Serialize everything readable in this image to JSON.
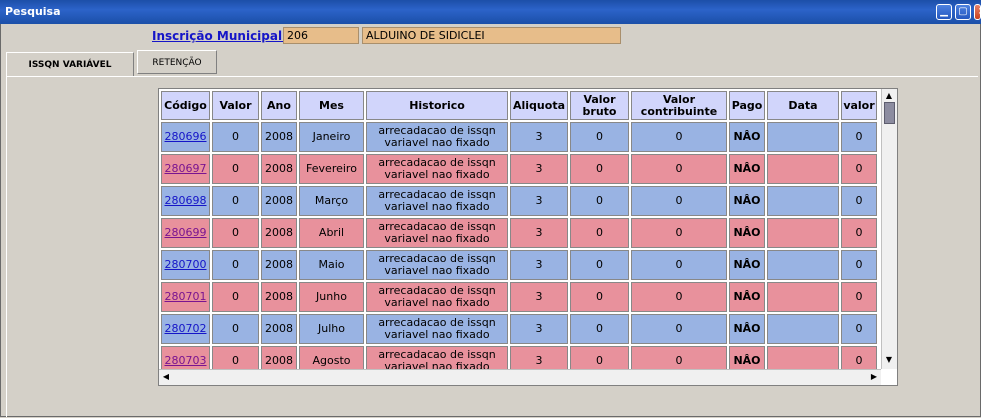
{
  "window": {
    "title": "Pesquisa"
  },
  "header": {
    "label": "Inscrição Municipal:",
    "inscricao": "206",
    "nome": "ALDUINO DE SIDICLEI"
  },
  "tabs": [
    {
      "label": "ISSQN VARIÁVEL",
      "active": true
    },
    {
      "label": "RETENÇÃO",
      "active": false
    }
  ],
  "table": {
    "columns": [
      "Código",
      "Valor",
      "Ano",
      "Mes",
      "Historico",
      "Aliquota",
      "Valor bruto",
      "Valor contribuinte",
      "Pago",
      "Data",
      "valor"
    ],
    "rows": [
      {
        "codigo": "280696",
        "valor": "0",
        "ano": "2008",
        "mes": "Janeiro",
        "historico": "arrecadacao de issqn variavel nao fixado",
        "aliquota": "3",
        "bruto": "0",
        "contribuinte": "0",
        "pago": "NÂO",
        "data": "",
        "valor2": "0"
      },
      {
        "codigo": "280697",
        "valor": "0",
        "ano": "2008",
        "mes": "Fevereiro",
        "historico": "arrecadacao de issqn variavel nao fixado",
        "aliquota": "3",
        "bruto": "0",
        "contribuinte": "0",
        "pago": "NÂO",
        "data": "",
        "valor2": "0"
      },
      {
        "codigo": "280698",
        "valor": "0",
        "ano": "2008",
        "mes": "Março",
        "historico": "arrecadacao de issqn variavel nao fixado",
        "aliquota": "3",
        "bruto": "0",
        "contribuinte": "0",
        "pago": "NÂO",
        "data": "",
        "valor2": "0"
      },
      {
        "codigo": "280699",
        "valor": "0",
        "ano": "2008",
        "mes": "Abril",
        "historico": "arrecadacao de issqn variavel nao fixado",
        "aliquota": "3",
        "bruto": "0",
        "contribuinte": "0",
        "pago": "NÂO",
        "data": "",
        "valor2": "0"
      },
      {
        "codigo": "280700",
        "valor": "0",
        "ano": "2008",
        "mes": "Maio",
        "historico": "arrecadacao de issqn variavel nao fixado",
        "aliquota": "3",
        "bruto": "0",
        "contribuinte": "0",
        "pago": "NÂO",
        "data": "",
        "valor2": "0"
      },
      {
        "codigo": "280701",
        "valor": "0",
        "ano": "2008",
        "mes": "Junho",
        "historico": "arrecadacao de issqn variavel nao fixado",
        "aliquota": "3",
        "bruto": "0",
        "contribuinte": "0",
        "pago": "NÂO",
        "data": "",
        "valor2": "0"
      },
      {
        "codigo": "280702",
        "valor": "0",
        "ano": "2008",
        "mes": "Julho",
        "historico": "arrecadacao de issqn variavel nao fixado",
        "aliquota": "3",
        "bruto": "0",
        "contribuinte": "0",
        "pago": "NÂO",
        "data": "",
        "valor2": "0"
      },
      {
        "codigo": "280703",
        "valor": "0",
        "ano": "2008",
        "mes": "Agosto",
        "historico": "arrecadacao de issqn variavel nao fixado",
        "aliquota": "3",
        "bruto": "0",
        "contribuinte": "0",
        "pago": "NÂO",
        "data": "",
        "valor2": "0"
      }
    ]
  },
  "colors": {
    "row_odd": "#99b3e3",
    "row_even": "#e8919c",
    "header_bg": "#d1d5fb",
    "field_bg": "#e7bd8a",
    "titlebar": "#2c63c9"
  },
  "icons": {
    "minimize": "minimize-icon",
    "maximize": "maximize-icon",
    "close": "close-icon"
  }
}
